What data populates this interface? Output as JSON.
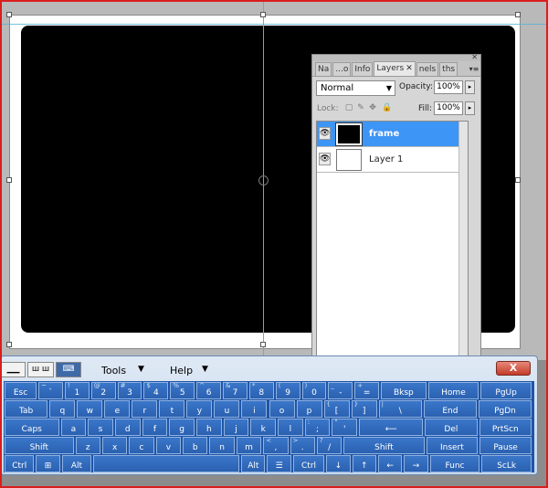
{
  "layers_panel": {
    "tabs": [
      {
        "label": "Na",
        "active": false
      },
      {
        "label": "...o",
        "active": false
      },
      {
        "label": "Info",
        "active": false
      },
      {
        "label": "Layers",
        "active": true
      },
      {
        "label": "nels",
        "active": false
      },
      {
        "label": "ths",
        "active": false
      }
    ],
    "blend_mode": "Normal",
    "opacity_label": "Opacity:",
    "opacity_value": "100%",
    "lock_label": "Lock:",
    "fill_label": "Fill:",
    "fill_value": "100%",
    "layers": [
      {
        "name": "frame",
        "selected": true,
        "thumb": "black"
      },
      {
        "name": "Layer 1",
        "selected": false,
        "thumb": "white"
      }
    ]
  },
  "keyboard": {
    "menu": {
      "tools": "Tools",
      "help": "Help"
    },
    "close": "X",
    "rows": [
      [
        {
          "t": "Esc"
        },
        {
          "t": "`",
          "s": "~"
        },
        {
          "t": "1",
          "s": "!"
        },
        {
          "t": "2",
          "s": "@"
        },
        {
          "t": "3",
          "s": "#"
        },
        {
          "t": "4",
          "s": "$"
        },
        {
          "t": "5",
          "s": "%"
        },
        {
          "t": "6",
          "s": "^"
        },
        {
          "t": "7",
          "s": "&"
        },
        {
          "t": "8",
          "s": "*"
        },
        {
          "t": "9",
          "s": "("
        },
        {
          "t": "0",
          "s": ")"
        },
        {
          "t": "-",
          "s": "_"
        },
        {
          "t": "=",
          "s": "+"
        },
        {
          "t": "Bksp"
        },
        {
          "t": "Home"
        },
        {
          "t": "PgUp"
        }
      ],
      [
        {
          "t": "Tab"
        },
        {
          "t": "q"
        },
        {
          "t": "w"
        },
        {
          "t": "e"
        },
        {
          "t": "r"
        },
        {
          "t": "t"
        },
        {
          "t": "y"
        },
        {
          "t": "u"
        },
        {
          "t": "i"
        },
        {
          "t": "o"
        },
        {
          "t": "p"
        },
        {
          "t": "[",
          "s": "{"
        },
        {
          "t": "]",
          "s": "}"
        },
        {
          "t": "\\",
          "s": "|"
        },
        {
          "t": "End"
        },
        {
          "t": "PgDn"
        }
      ],
      [
        {
          "t": "Caps"
        },
        {
          "t": "a"
        },
        {
          "t": "s"
        },
        {
          "t": "d"
        },
        {
          "t": "f"
        },
        {
          "t": "g"
        },
        {
          "t": "h"
        },
        {
          "t": "j"
        },
        {
          "t": "k"
        },
        {
          "t": "l"
        },
        {
          "t": ";",
          "s": ":"
        },
        {
          "t": "'",
          "s": "\""
        },
        {
          "t": "⟵"
        },
        {
          "t": "Del"
        },
        {
          "t": "PrtScn"
        }
      ],
      [
        {
          "t": "Shift"
        },
        {
          "t": "z"
        },
        {
          "t": "x"
        },
        {
          "t": "c"
        },
        {
          "t": "v"
        },
        {
          "t": "b"
        },
        {
          "t": "n"
        },
        {
          "t": "m"
        },
        {
          "t": ",",
          "s": "<"
        },
        {
          "t": ".",
          "s": ">"
        },
        {
          "t": "/",
          "s": "?"
        },
        {
          "t": "Shift"
        },
        {
          "t": "Insert"
        },
        {
          "t": "Pause"
        }
      ],
      [
        {
          "t": "Ctrl"
        },
        {
          "t": "⊞"
        },
        {
          "t": "Alt"
        },
        {
          "t": ""
        },
        {
          "t": "Alt"
        },
        {
          "t": "☰"
        },
        {
          "t": "Ctrl"
        },
        {
          "t": "↓"
        },
        {
          "t": "↑"
        },
        {
          "t": "←"
        },
        {
          "t": "→"
        },
        {
          "t": "Func"
        },
        {
          "t": "ScLk"
        }
      ]
    ]
  }
}
